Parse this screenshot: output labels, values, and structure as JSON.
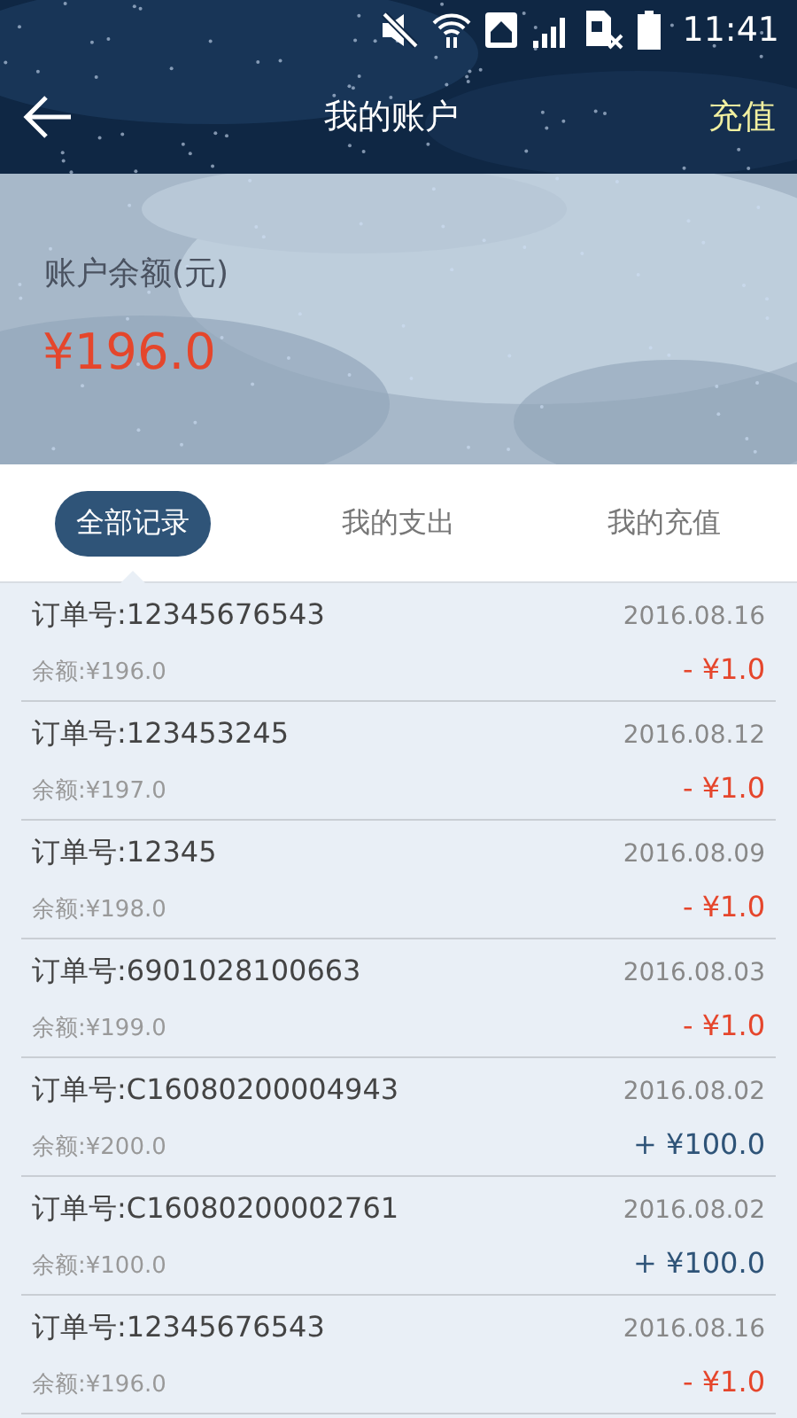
{
  "status_bar": {
    "time": "11:41"
  },
  "app_bar": {
    "title": "我的账户",
    "action": "充值"
  },
  "balance": {
    "label": "账户余额(元)",
    "amount": "¥196.0"
  },
  "tabs": [
    {
      "label": "全部记录",
      "selected": true
    },
    {
      "label": "我的支出",
      "selected": false
    },
    {
      "label": "我的充值",
      "selected": false
    }
  ],
  "records": [
    {
      "order": "订单号:12345676543",
      "date": "2016.08.16",
      "balance": "余额:¥196.0",
      "amount": "- ¥1.0",
      "kind": "expense"
    },
    {
      "order": "订单号:123453245",
      "date": "2016.08.12",
      "balance": "余额:¥197.0",
      "amount": "- ¥1.0",
      "kind": "expense"
    },
    {
      "order": "订单号:12345",
      "date": "2016.08.09",
      "balance": "余额:¥198.0",
      "amount": "- ¥1.0",
      "kind": "expense"
    },
    {
      "order": "订单号:6901028100663",
      "date": "2016.08.03",
      "balance": "余额:¥199.0",
      "amount": "- ¥1.0",
      "kind": "expense"
    },
    {
      "order": "订单号:C16080200004943",
      "date": "2016.08.02",
      "balance": "余额:¥200.0",
      "amount": "+ ¥100.0",
      "kind": "income"
    },
    {
      "order": "订单号:C16080200002761",
      "date": "2016.08.02",
      "balance": "余额:¥100.0",
      "amount": "+ ¥100.0",
      "kind": "income"
    },
    {
      "order": "订单号:12345676543",
      "date": "2016.08.16",
      "balance": "余额:¥196.0",
      "amount": "- ¥1.0",
      "kind": "expense"
    }
  ]
}
